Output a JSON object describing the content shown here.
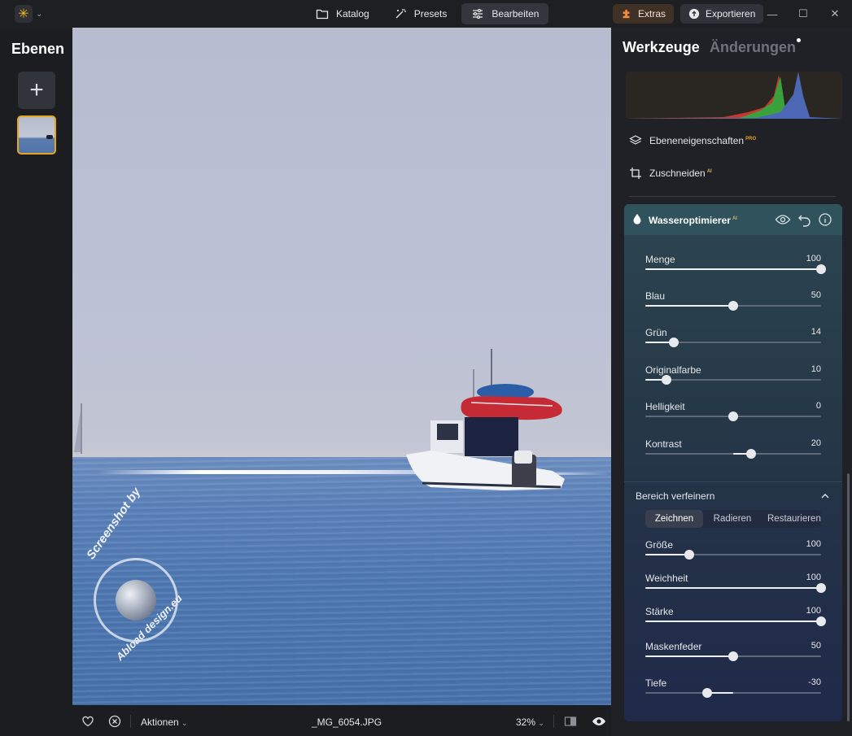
{
  "titlebar": {
    "nav": [
      {
        "label": "Katalog",
        "icon": "folder-icon"
      },
      {
        "label": "Presets",
        "icon": "magic-wand-icon"
      },
      {
        "label": "Bearbeiten",
        "icon": "sliders-icon",
        "active": true
      }
    ],
    "extras_label": "Extras",
    "export_label": "Exportieren"
  },
  "left_panel": {
    "title": "Ebenen"
  },
  "bottom_bar": {
    "actions_label": "Aktionen",
    "filename": "_MG_6054.JPG",
    "zoom": "32%"
  },
  "watermark": {
    "top_text": "Screenshot by",
    "bottom_text": "Abload design.eu"
  },
  "right_panel": {
    "tab_tools": "Werkzeuge",
    "tab_changes": "Änderungen",
    "tools": [
      {
        "label": "Ebeneneigenschaften",
        "badge": "PRO",
        "icon": "layers-icon"
      },
      {
        "label": "Zuschneiden",
        "badge": "AI",
        "icon": "crop-icon"
      }
    ],
    "card": {
      "title": "Wasseroptimierer",
      "badge": "AI",
      "sliders": [
        {
          "label": "Menge",
          "value": "100",
          "fraction": 1.0,
          "origin": 0
        },
        {
          "label": "Blau",
          "value": "50",
          "fraction": 0.5,
          "origin": 0
        },
        {
          "label": "Grün",
          "value": "14",
          "fraction": 0.16,
          "origin": 0
        },
        {
          "label": "Originalfarbe",
          "value": "10",
          "fraction": 0.12,
          "origin": 0
        },
        {
          "label": "Helligkeit",
          "value": "0",
          "fraction": 0.5,
          "origin": 0.5
        },
        {
          "label": "Kontrast",
          "value": "20",
          "fraction": 0.6,
          "origin": 0.5
        }
      ],
      "refine": {
        "title": "Bereich verfeinern",
        "modes": [
          "Zeichnen",
          "Radieren",
          "Restaurieren"
        ],
        "active_mode": "Zeichnen",
        "sliders": [
          {
            "label": "Größe",
            "value": "100",
            "fraction": 0.25,
            "origin": 0
          },
          {
            "label": "Weichheit",
            "value": "100",
            "fraction": 1.0,
            "origin": 0
          },
          {
            "label": "Stärke",
            "value": "100",
            "fraction": 1.0,
            "origin": 0
          },
          {
            "label": "Maskenfeder",
            "value": "50",
            "fraction": 0.5,
            "origin": 0
          },
          {
            "label": "Tiefe",
            "value": "-30",
            "fraction": 0.35,
            "origin": 0.5
          }
        ]
      }
    }
  },
  "colors": {
    "accent": "#e5a520",
    "panel_bg": "#1f2126",
    "card_header": "#2f525c"
  }
}
